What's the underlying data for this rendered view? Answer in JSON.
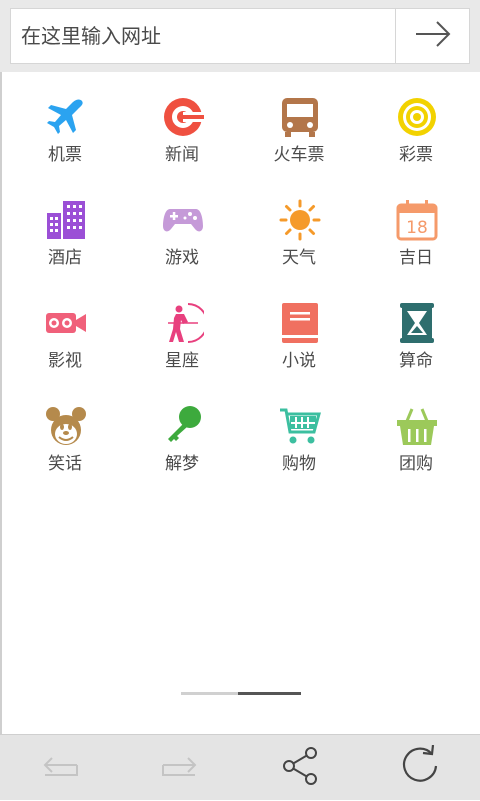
{
  "search": {
    "placeholder": "在这里输入网址"
  },
  "go_icon": "arrow-right-icon",
  "grid": [
    {
      "label": "机票",
      "icon": "airplane-icon",
      "color": "#2ba3f0"
    },
    {
      "label": "新闻",
      "icon": "news-icon",
      "color": "#ef5040"
    },
    {
      "label": "火车票",
      "icon": "bus-icon",
      "color": "#b3764a"
    },
    {
      "label": "彩票",
      "icon": "lottery-icon",
      "color": "#f2d200"
    },
    {
      "label": "酒店",
      "icon": "hotel-icon",
      "color": "#9b4fd6"
    },
    {
      "label": "游戏",
      "icon": "gamepad-icon",
      "color": "#c59ad8"
    },
    {
      "label": "天气",
      "icon": "sun-icon",
      "color": "#f59a2a"
    },
    {
      "label": "吉日",
      "icon": "calendar-icon",
      "color": "#f59a6a"
    },
    {
      "label": "影视",
      "icon": "camera-icon",
      "color": "#f0607a"
    },
    {
      "label": "星座",
      "icon": "archer-icon",
      "color": "#e8407e"
    },
    {
      "label": "小说",
      "icon": "book-icon",
      "color": "#f07060"
    },
    {
      "label": "算命",
      "icon": "hourglass-icon",
      "color": "#2e6e6e"
    },
    {
      "label": "笑话",
      "icon": "mickey-icon",
      "color": "#b58a4c"
    },
    {
      "label": "解梦",
      "icon": "key-icon",
      "color": "#3daa3d"
    },
    {
      "label": "购物",
      "icon": "cart-icon",
      "color": "#3cbfa0"
    },
    {
      "label": "团购",
      "icon": "basket-icon",
      "color": "#9cc95a"
    }
  ],
  "pager": {
    "pages": 2,
    "current": 2
  },
  "bottom_bar": [
    {
      "icon": "back-icon",
      "enabled": false
    },
    {
      "icon": "forward-icon",
      "enabled": false
    },
    {
      "icon": "share-icon",
      "enabled": true
    },
    {
      "icon": "refresh-icon",
      "enabled": true
    }
  ]
}
